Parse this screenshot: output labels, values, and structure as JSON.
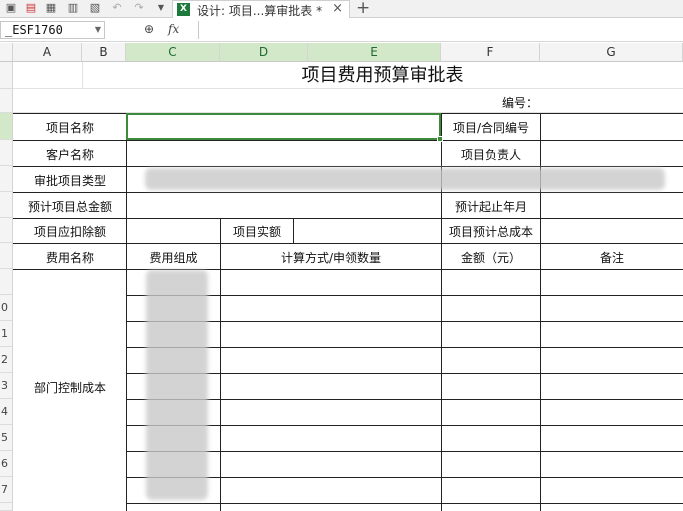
{
  "toolbar": {
    "tab_title": "设计: 项目...算审批表 *",
    "tab_close": "×",
    "tab_add": "+",
    "tab_badge": "X"
  },
  "formula_bar": {
    "name_box": "_ESF1760",
    "zoom_glyph": "⊕",
    "fx_label": "fx",
    "value": ""
  },
  "columns": [
    "A",
    "B",
    "C",
    "D",
    "E",
    "F",
    "G"
  ],
  "row_numbers": [
    "",
    "",
    "",
    "",
    "",
    "",
    "",
    "",
    "",
    "0",
    "1",
    "2",
    "3",
    "4",
    "5",
    "6",
    "7"
  ],
  "sheet": {
    "title": "项目费用预算审批表",
    "serial_label": "编号：",
    "rows": {
      "project_name_label": "项目名称",
      "contract_no_label": "项目/合同编号",
      "client_name_label": "客户名称",
      "project_lead_label": "项目负责人",
      "approval_type_label": "审批项目类型",
      "estimated_total_label": "预计项目总金额",
      "estimated_period_label": "预计起止年月",
      "deduction_label": "项目应扣除额",
      "actual_amount_label": "项目实额",
      "estimated_cost_label": "项目预计总成本",
      "expense_name_header": "费用名称",
      "expense_composition_header": "费用组成",
      "calc_method_header": "计算方式/申领数量",
      "amount_header": "金额（元）",
      "remarks_header": "备注",
      "dept_cost_label": "部门控制成本"
    }
  }
}
